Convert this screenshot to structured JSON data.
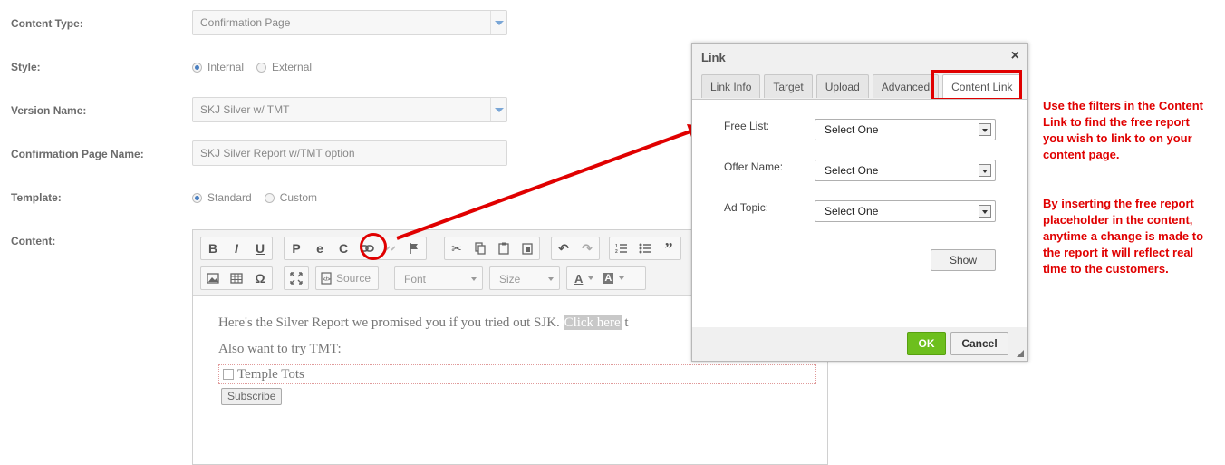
{
  "form": {
    "content_type_label": "Content Type:",
    "content_type_value": "Confirmation Page",
    "style_label": "Style:",
    "style_internal": "Internal",
    "style_external": "External",
    "version_name_label": "Version Name:",
    "version_name_value": "SKJ Silver w/ TMT",
    "confirmation_page_name_label": "Confirmation Page Name:",
    "confirmation_page_name_value": "SKJ Silver Report w/TMT option",
    "template_label": "Template:",
    "template_standard": "Standard",
    "template_custom": "Custom",
    "content_label": "Content:"
  },
  "editor": {
    "bold_glyph": "B",
    "italic_glyph": "I",
    "underline_glyph": "U",
    "source_label": "Source",
    "font_label": "Font",
    "size_label": "Size",
    "omega_glyph": "Ω",
    "text_color_glyph": "A",
    "bg_color_glyph": "A",
    "body_line1_prefix": "Here's the Silver Report we promised you if you tried out SJK.",
    "body_link_text": "Click here",
    "body_line1_suffix": "t",
    "body_line2": "Also want to try TMT:",
    "checkbox_label": "Temple Tots",
    "subscribe_label": "Subscribe"
  },
  "dialog": {
    "title": "Link",
    "close_glyph": "×",
    "tabs": [
      "Link Info",
      "Target",
      "Upload",
      "Advanced",
      "Content Link"
    ],
    "free_list_label": "Free List:",
    "free_list_value": "Select One",
    "offer_name_label": "Offer Name:",
    "offer_name_value": "Select One",
    "ad_topic_label": "Ad Topic:",
    "ad_topic_value": "Select One",
    "show_label": "Show",
    "ok_label": "OK",
    "cancel_label": "Cancel"
  },
  "annotation": {
    "para1": "Use the filters in the Content Link to find the free report you wish to link to on your content page.",
    "para2": "By inserting the free report placeholder in the content, anytime a change is made to the report it will reflect real time to the customers."
  },
  "colors": {
    "highlight_red": "#e00000",
    "ok_green": "#6dbf1d",
    "radio_blue": "#4a7fc1"
  }
}
